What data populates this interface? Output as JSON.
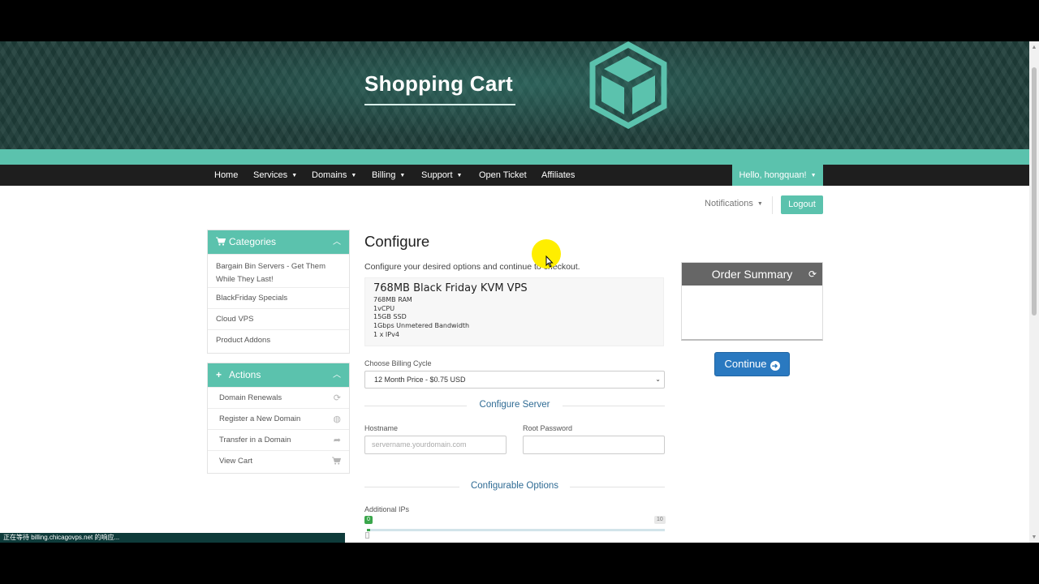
{
  "header": {
    "title": "Shopping Cart"
  },
  "navbar": {
    "items": [
      {
        "label": "Home",
        "dropdown": false
      },
      {
        "label": "Services",
        "dropdown": true
      },
      {
        "label": "Domains",
        "dropdown": true
      },
      {
        "label": "Billing",
        "dropdown": true
      },
      {
        "label": "Support",
        "dropdown": true
      },
      {
        "label": "Open Ticket",
        "dropdown": false
      },
      {
        "label": "Affiliates",
        "dropdown": false
      }
    ],
    "user_menu": "Hello, hongquan!"
  },
  "topbar": {
    "notifications": "Notifications",
    "logout": "Logout"
  },
  "sidebar": {
    "categories": {
      "title": "Categories",
      "items": [
        {
          "label": "Bargain Bin Servers - Get Them While They Last!"
        },
        {
          "label": "BlackFriday Specials"
        },
        {
          "label": "Cloud VPS"
        },
        {
          "label": "Product Addons"
        }
      ]
    },
    "actions": {
      "title": "Actions",
      "items": [
        {
          "label": "Domain Renewals",
          "icon": "refresh-icon"
        },
        {
          "label": "Register a New Domain",
          "icon": "globe-icon"
        },
        {
          "label": "Transfer in a Domain",
          "icon": "share-icon"
        },
        {
          "label": "View Cart",
          "icon": "cart-icon"
        }
      ]
    }
  },
  "main": {
    "title": "Configure",
    "subtitle": "Configure your desired options and continue to checkout.",
    "product": {
      "name": "768MB Black Friday KVM VPS",
      "specs": [
        "768MB RAM",
        "1vCPU",
        "15GB SSD",
        "1Gbps Unmetered Bandwidth",
        "1 x IPv4"
      ]
    },
    "billing": {
      "label": "Choose Billing Cycle",
      "selected": "12 Month Price - $0.75 USD"
    },
    "configure_server": {
      "heading": "Configure Server",
      "hostname_label": "Hostname",
      "hostname_placeholder": "servername.yourdomain.com",
      "root_password_label": "Root Password",
      "root_password_placeholder": ""
    },
    "configurable_options": {
      "heading": "Configurable Options",
      "additional_ips_label": "Additional IPs",
      "slider_min": "0",
      "slider_max": "10",
      "slider_value": 0
    }
  },
  "order_summary": {
    "title": "Order Summary",
    "continue_label": "Continue"
  },
  "status_bar": {
    "text": "正在等待 billing.chicagovps.net 的响应..."
  },
  "colors": {
    "accent": "#5bc2ad",
    "navbar": "#1e1e1e",
    "button_blue": "#2a79c0",
    "section_heading": "#2f6b94",
    "slider_green": "#3aa64b"
  }
}
